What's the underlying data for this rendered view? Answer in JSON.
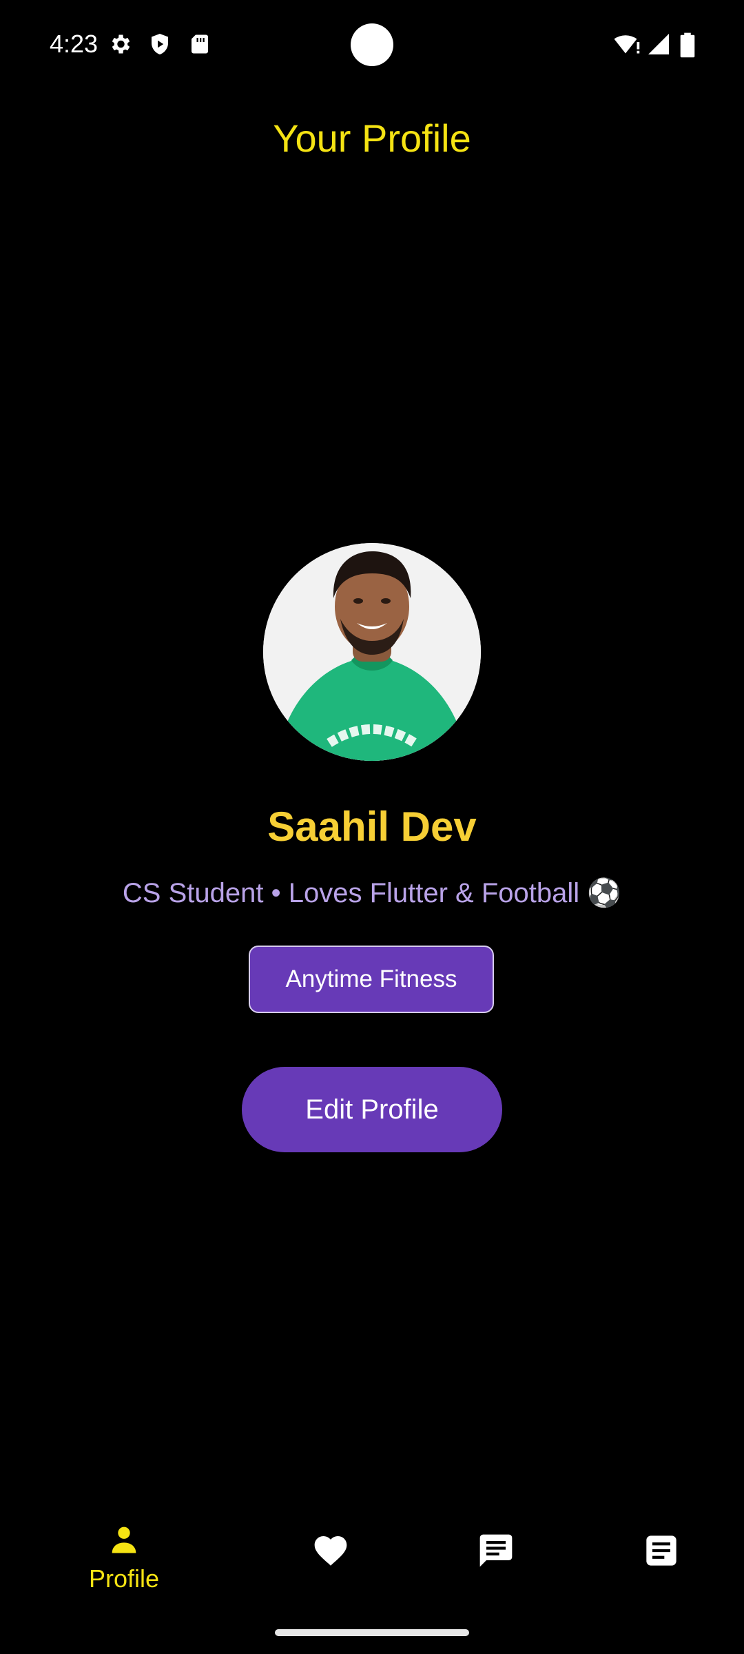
{
  "status_bar": {
    "time": "4:23",
    "left_icons": [
      "gear-icon",
      "shield-play-icon",
      "sd-card-icon"
    ],
    "right_icons": [
      "wifi-alert-icon",
      "cell-signal-icon",
      "battery-icon"
    ]
  },
  "header": {
    "title": "Your Profile",
    "title_color": "#f5e313"
  },
  "profile": {
    "avatar_description": "profile-photo",
    "name": "Saahil Dev",
    "name_color": "#f7cf35",
    "bio": "CS Student • Loves Flutter & Football ⚽",
    "bio_color": "#b9a3e8",
    "gym_badge": "Anytime Fitness",
    "edit_button_label": "Edit Profile",
    "accent_color": "#673ab7"
  },
  "bottom_nav": {
    "items": [
      {
        "icon": "person-icon",
        "label": "Profile",
        "active": true
      },
      {
        "icon": "heart-icon",
        "label": "",
        "active": false
      },
      {
        "icon": "chat-icon",
        "label": "",
        "active": false
      },
      {
        "icon": "notes-icon",
        "label": "",
        "active": false
      }
    ],
    "active_color": "#f5e313"
  }
}
